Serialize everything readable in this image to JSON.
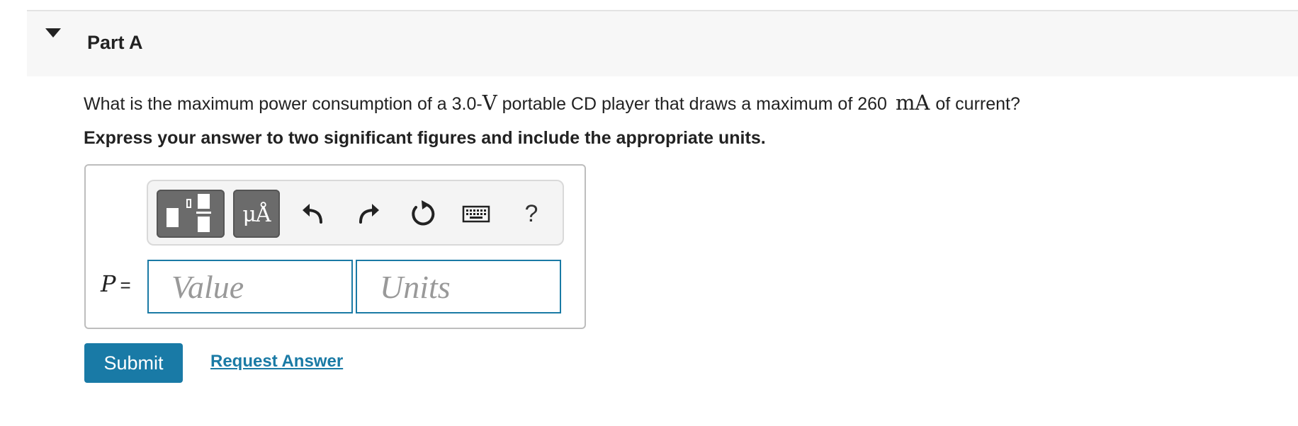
{
  "part": {
    "title": "Part A"
  },
  "question": {
    "text_before": "What is the maximum power consumption of a 3.0-",
    "unit_voltage": "V",
    "text_middle": " portable CD player that draws a maximum of 260",
    "unit_current": "mA",
    "text_after": "of current?"
  },
  "instruction": "Express your answer to two significant figures and include the appropriate units.",
  "toolbar": {
    "template_icon": "fraction-template-icon",
    "units_label": "μÅ",
    "undo_icon": "undo-icon",
    "redo_icon": "redo-icon",
    "reset_icon": "reset-icon",
    "keyboard_icon": "keyboard-icon",
    "help_label": "?"
  },
  "answer": {
    "variable": "P",
    "equals": "=",
    "value_placeholder": "Value",
    "units_placeholder": "Units"
  },
  "actions": {
    "submit_label": "Submit",
    "request_label": "Request Answer"
  },
  "colors": {
    "accent": "#197aa6",
    "toolbar_button": "#6b6b6b",
    "header_bg": "#f7f7f7"
  }
}
